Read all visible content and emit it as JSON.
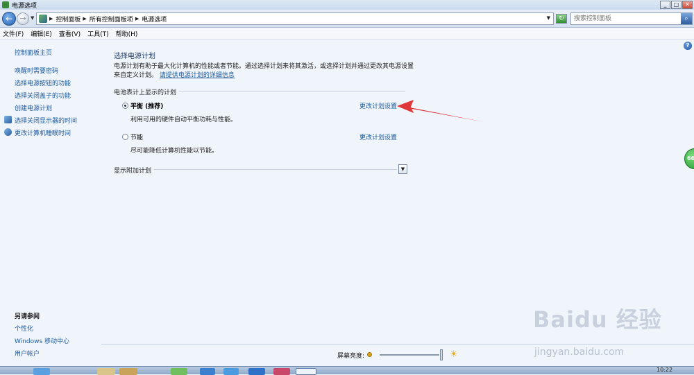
{
  "window": {
    "title": "电源选项",
    "buttons": {
      "minimize": "_",
      "maximize": "□",
      "close": "✕"
    }
  },
  "address": {
    "breadcrumbs": [
      "控制面板",
      "所有控制面板项",
      "电源选项"
    ],
    "search_placeholder": "搜索控制面板"
  },
  "menu": [
    "文件(F)",
    "编辑(E)",
    "查看(V)",
    "工具(T)",
    "帮助(H)"
  ],
  "sidebar": {
    "home": "控制面板主页",
    "links": [
      "唤醒时需要密码",
      "选择电源按钮的功能",
      "选择关闭盖子的功能",
      "创建电源计划",
      "选择关闭显示器的时间",
      "更改计算机睡眠时间"
    ],
    "see_also_title": "另请参阅",
    "see_also": [
      "个性化",
      "Windows 移动中心",
      "用户帐户"
    ]
  },
  "main": {
    "heading": "选择电源计划",
    "description": "电源计划有助于最大化计算机的性能或者节能。通过选择计划来将其激活，或选择计划并通过更改其电源设置来自定义计划。",
    "info_link": "请提供电源计划的详细信息",
    "group_label": "电池表计上显示的计划",
    "plans": [
      {
        "name": "平衡 (推荐)",
        "desc": "利用可用的硬件自动平衡功耗与性能。",
        "link": "更改计划设置",
        "selected": true
      },
      {
        "name": "节能",
        "desc": "尽可能降低计算机性能以节能。",
        "link": "更改计划设置",
        "selected": false
      }
    ],
    "more_plans": "显示附加计划"
  },
  "brightness": {
    "label": "屏幕亮度:",
    "level": 1.0
  },
  "side_badge": "66",
  "taskbar_clock": "10:22",
  "watermark": {
    "logo": "Baidu 经验",
    "url": "jingyan.baidu.com"
  },
  "colors": {
    "link": "#1c5a9e",
    "arrow": "#e0383a",
    "badge": "#1f9a2f"
  }
}
